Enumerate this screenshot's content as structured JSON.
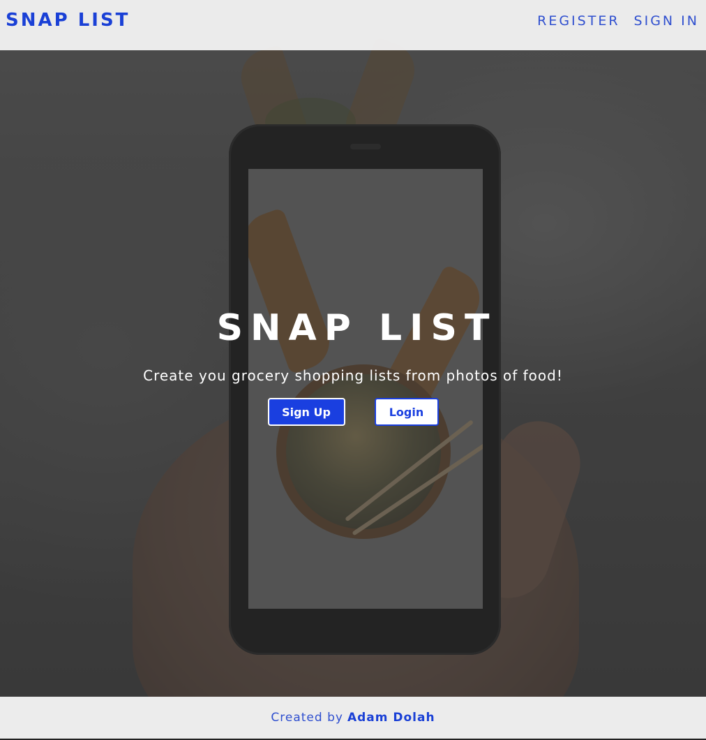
{
  "navbar": {
    "brand": "SNAP LIST",
    "links": [
      {
        "label": "REGISTER"
      },
      {
        "label": "SIGN IN"
      }
    ]
  },
  "hero": {
    "title": "SNAP LIST",
    "subtitle": "Create you grocery shopping lists from photos of food!",
    "signup_label": "Sign Up",
    "login_label": "Login"
  },
  "footer": {
    "prefix": "Created by",
    "author": "Adam Dolah"
  },
  "colors": {
    "brand_blue": "#1a40d6",
    "button_blue": "#1a3fe0",
    "navbar_bg": "#eeeeee"
  }
}
